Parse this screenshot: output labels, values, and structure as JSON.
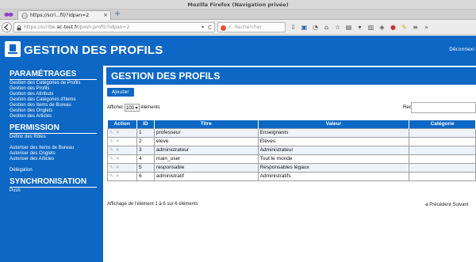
{
  "browser": {
    "window_title": "Mozilla Firefox (Navigation privée)",
    "tab_title": "https://scri...fil/?idpan=2",
    "tab_close": "×",
    "new_tab": "+",
    "url_host": "https://scribe.",
    "url_domain": "ac-test.fr",
    "url_path": "/posh-profil/?idpan=2",
    "url_dropdown": "▾",
    "reload": "C",
    "search_placeholder": "Rechercher",
    "search_icon": "magnifier-icon",
    "toolbar_icons": [
      "download-icon",
      "save-icon",
      "history-icon",
      "home-icon",
      "bookmark-star-icon",
      "clipboard-icon",
      "pocket-icon",
      "library-icon",
      "extension-icon",
      "stop-icon",
      "tool-icon",
      "menu-icon",
      "overflow-icon"
    ]
  },
  "header": {
    "title": "GESTION DES PROFILS",
    "logout": "Déconnexi"
  },
  "sidebar": {
    "sections": [
      {
        "title": "PARAMÉTRAGES",
        "links": [
          "Gestion des Catégories de Profils",
          "Gestion des Profils",
          "Gestion des Attributs",
          "Gestion des Catégories d'Items",
          "Gestion des Items de Bureau",
          "Gestion des Onglets",
          "Gestion des Articles"
        ]
      },
      {
        "title": "PERMISSION",
        "links": [
          "Définir des Rôles",
          "",
          "Autoriser des Items de Bureau",
          "Autoriser des Onglets",
          "Autoriser des Articles",
          "",
          "Délégation"
        ]
      },
      {
        "title": "SYNCHRONISATION",
        "links": [
          "Posh"
        ]
      }
    ]
  },
  "main": {
    "title": "GESTION DES PROFILS",
    "add_button": "Ajouter",
    "length_prefix": "Afficher",
    "length_value": "100",
    "length_suffix": "éléments",
    "search_label": "Rechercher :",
    "columns": [
      "Action",
      "ID",
      "Titre",
      "Valeur",
      "Catégorie"
    ],
    "rows": [
      {
        "id": "1",
        "titre": "professeur",
        "valeur": "Enseignants",
        "categorie": ""
      },
      {
        "id": "2",
        "titre": "eleve",
        "valeur": "Elèves",
        "categorie": ""
      },
      {
        "id": "3",
        "titre": "administrateur",
        "valeur": "Administrateur",
        "categorie": ""
      },
      {
        "id": "4",
        "titre": "main_user",
        "valeur": "Tout le monde",
        "categorie": ""
      },
      {
        "id": "5",
        "titre": "responsable",
        "valeur": "Responsables légaux",
        "categorie": ""
      },
      {
        "id": "6",
        "titre": "administratif",
        "valeur": "Administratifs",
        "categorie": ""
      }
    ],
    "action_icons": "✎ ✕",
    "info": "Affichage de l'élément 1 à 6 sur 6 éléments",
    "prev": "Précédent",
    "next": "Suivant"
  }
}
